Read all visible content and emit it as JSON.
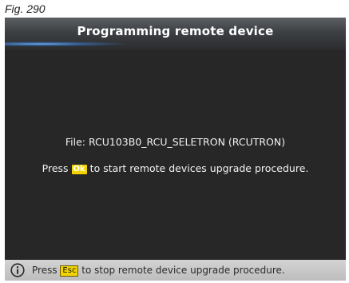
{
  "figure": {
    "caption": "Fig. 290"
  },
  "screen": {
    "title": "Programming remote device",
    "file_line": "File: RCU103B0_RCU_SELETRON (RCUTRON)",
    "instruction": {
      "prefix": "Press",
      "key": "Ok",
      "suffix": "to start remote devices upgrade procedure."
    }
  },
  "status_bar": {
    "icon": "info-icon",
    "prefix": "Press",
    "key": "Esc",
    "suffix": "to stop remote device upgrade procedure."
  },
  "colors": {
    "screen_background": "#272727",
    "key_highlight": "#f3d400",
    "status_bar_background": "#c8c8c8"
  }
}
